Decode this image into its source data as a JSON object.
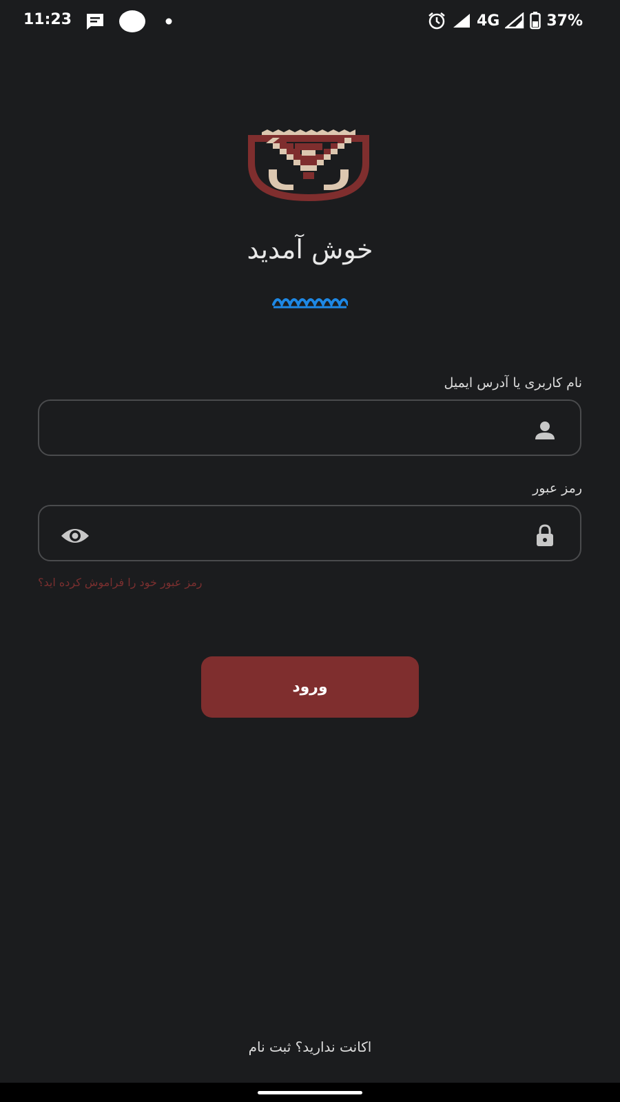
{
  "status_bar": {
    "time": "11:23",
    "network": "4G",
    "battery": "37%",
    "icons": [
      "message-icon",
      "circle-icon",
      "dot-icon",
      "alarm-icon",
      "signal-icon",
      "signal-icon",
      "battery-icon"
    ]
  },
  "logo": {
    "icon": "basket-logo",
    "colors": [
      "#7f2e2e",
      "#dcc7b0"
    ]
  },
  "welcome": {
    "title": "خوش آمدید",
    "decoration": "wave-icon",
    "decoration_color": "#1e88e5"
  },
  "username": {
    "label": "نام کاربری یا آدرس ایمیل",
    "value": "",
    "placeholder": "",
    "icon": "person-icon"
  },
  "password": {
    "label": "رمز عبور",
    "value": "",
    "placeholder": "",
    "icon": "lock-icon",
    "toggle_icon": "eye-icon"
  },
  "forgot_password": "رمز عبور خود را فراموش کرده اید؟",
  "login_button": {
    "label": "ورود",
    "color": "#7f2e2e"
  },
  "signup_link": "اکانت ندارید؟ ثبت نام"
}
